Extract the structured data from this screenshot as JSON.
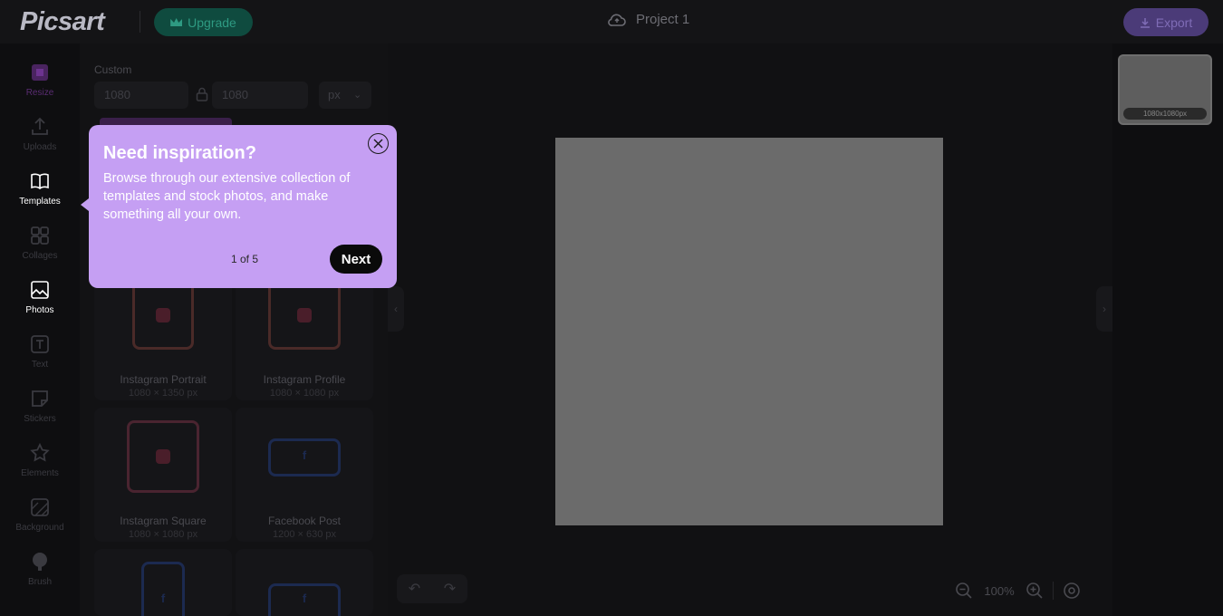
{
  "header": {
    "logo": "Picsart",
    "upgrade_label": "Upgrade",
    "project_title": "Project 1",
    "export_label": "Export"
  },
  "sidebar": {
    "items": [
      {
        "label": "Resize",
        "icon": "resize-icon"
      },
      {
        "label": "Uploads",
        "icon": "upload-icon"
      },
      {
        "label": "Templates",
        "icon": "book-icon"
      },
      {
        "label": "Collages",
        "icon": "grid-icon"
      },
      {
        "label": "Photos",
        "icon": "image-icon"
      },
      {
        "label": "Text",
        "icon": "text-icon"
      },
      {
        "label": "Stickers",
        "icon": "sticker-icon"
      },
      {
        "label": "Elements",
        "icon": "star-icon"
      },
      {
        "label": "Background",
        "icon": "background-icon"
      },
      {
        "label": "Brush",
        "icon": "brush-icon"
      }
    ]
  },
  "panel": {
    "section_label": "Custom",
    "width_value": "1080",
    "height_value": "1080",
    "unit": "px",
    "presets": [
      {
        "name": "Instagram Portrait",
        "size": "1080 × 1350 px"
      },
      {
        "name": "Instagram Profile",
        "size": "1080 × 1080 px"
      },
      {
        "name": "Instagram Square",
        "size": "1080 × 1080 px"
      },
      {
        "name": "Facebook Post",
        "size": "1200 × 630 px"
      }
    ]
  },
  "canvas": {
    "zoom": "100%",
    "page_label": "1080x1080px"
  },
  "popover": {
    "title": "Need inspiration?",
    "body": "Browse through our extensive collection of templates and stock photos, and make something all your own.",
    "step": "1 of 5",
    "next_label": "Next"
  },
  "colors": {
    "popover_bg": "#c59ff3",
    "accent_purple": "#6a4fb0",
    "upgrade_green": "#0f4b3f"
  }
}
